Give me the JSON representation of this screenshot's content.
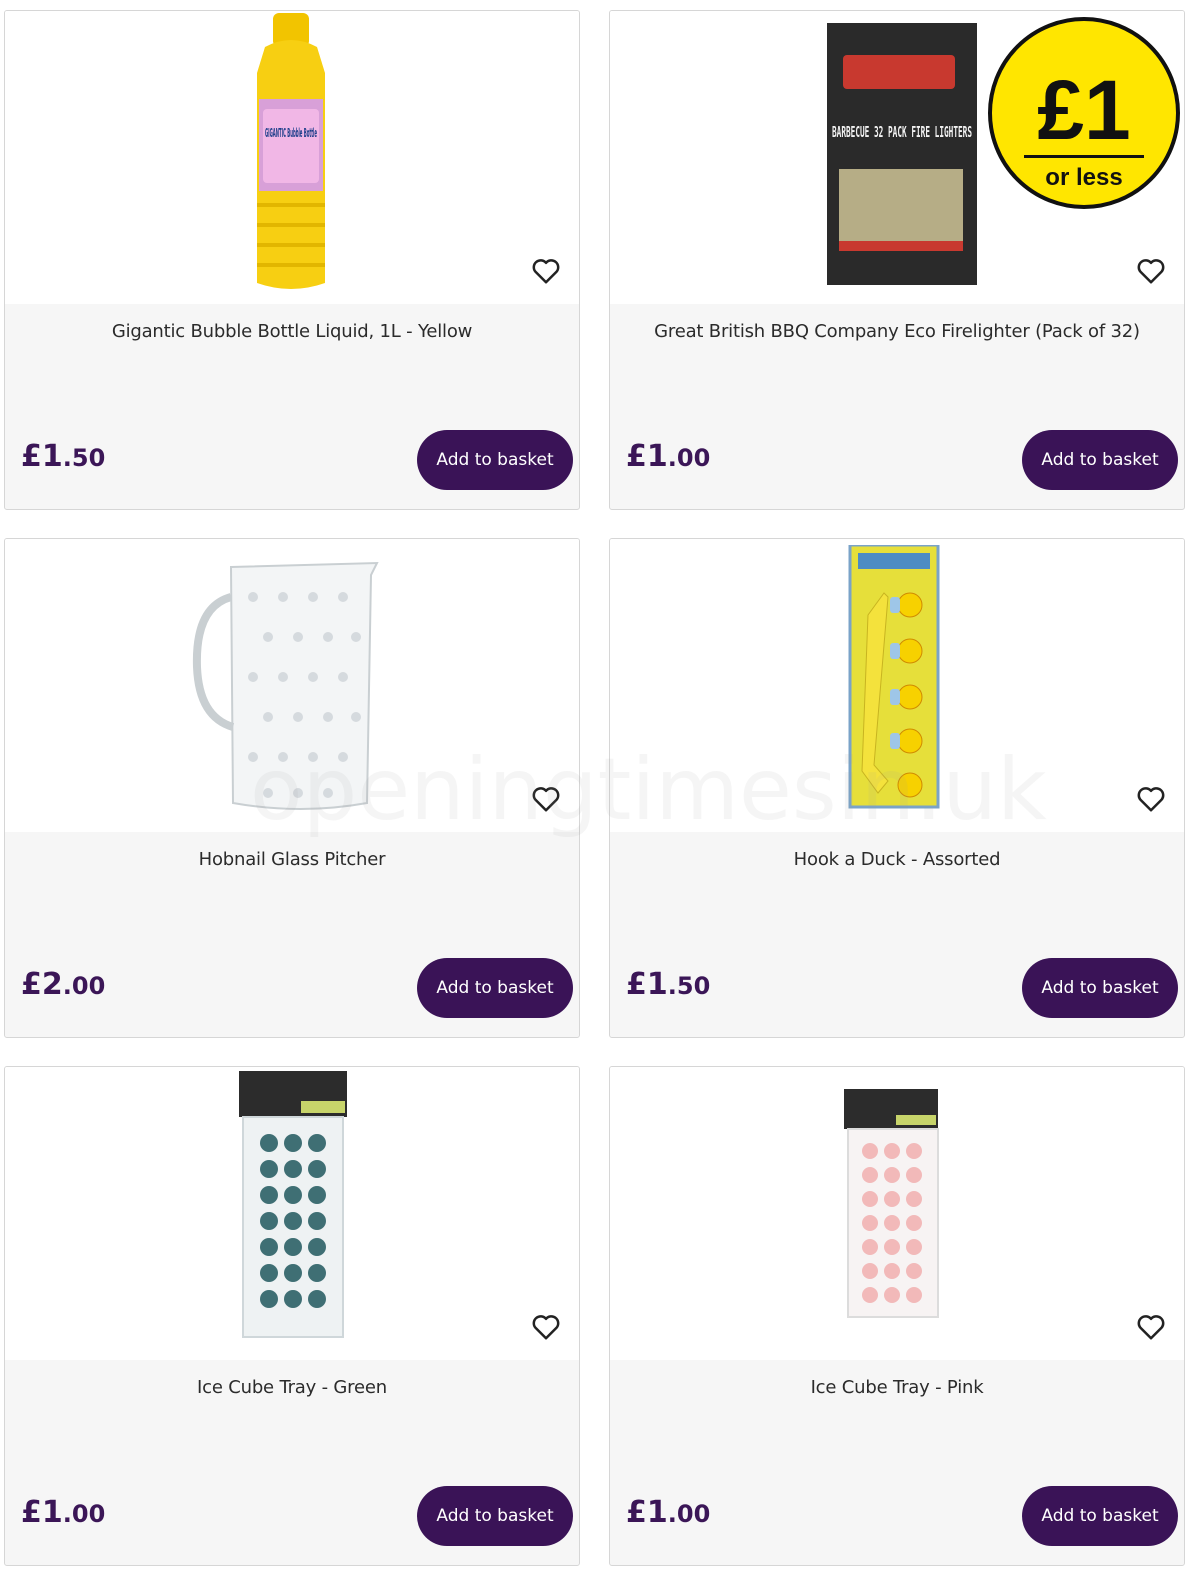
{
  "colors": {
    "brand": "#3a1357",
    "price": "#3b1657",
    "badge_yellow": "#ffe600"
  },
  "products": [
    {
      "title": "Gigantic Bubble Bottle Liquid, 1L - Yellow",
      "price_pounds": "£1",
      "price_pence": ".50",
      "button": "Add to basket",
      "image_text": "GIGANTIC Bubble Bottle"
    },
    {
      "title": "Great British BBQ Company Eco Firelighter (Pack of 32)",
      "price_pounds": "£1",
      "price_pence": ".00",
      "button": "Add to basket",
      "image_text": "BARBECUE 32 PACK FIRE LIGHTERS",
      "badge_main": "£1",
      "badge_sub": "or less"
    },
    {
      "title": "Hobnail Glass Pitcher",
      "price_pounds": "£2",
      "price_pence": ".00",
      "button": "Add to basket"
    },
    {
      "title": "Hook a Duck - Assorted",
      "price_pounds": "£1",
      "price_pence": ".50",
      "button": "Add to basket"
    },
    {
      "title": "Ice Cube Tray - Green",
      "price_pounds": "£1",
      "price_pence": ".00",
      "button": "Add to basket"
    },
    {
      "title": "Ice Cube Tray - Pink",
      "price_pounds": "£1",
      "price_pence": ".00",
      "button": "Add to basket"
    }
  ],
  "watermark": "openingtimesin.uk"
}
